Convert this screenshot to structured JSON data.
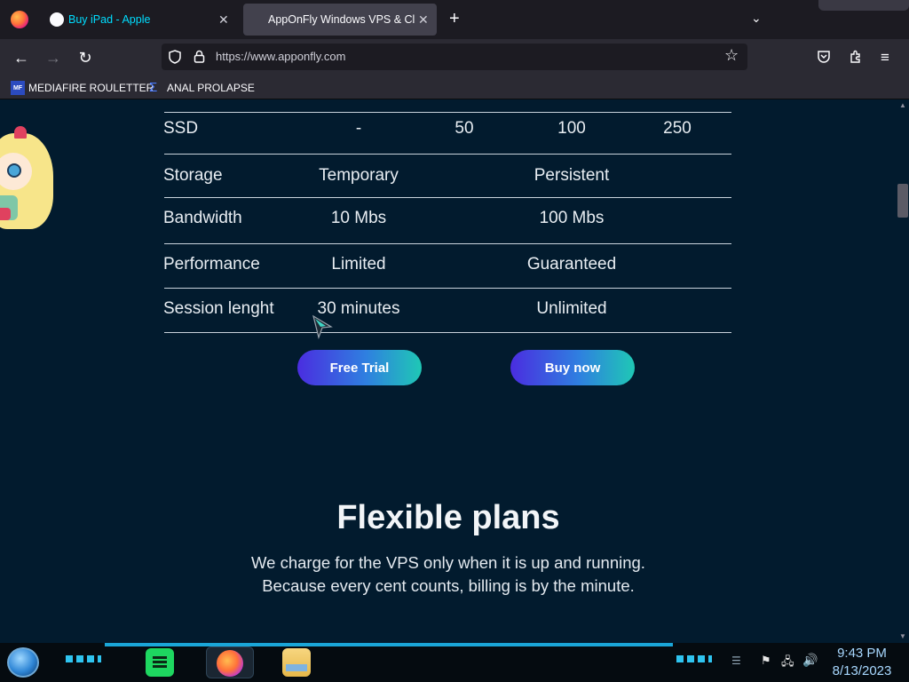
{
  "browser": {
    "tabs": [
      {
        "label": "Buy iPad - Apple",
        "active": false
      },
      {
        "label": "AppOnFly Windows VPS & Clo",
        "active": true
      }
    ],
    "url": "https://www.apponfly.com",
    "bookmarks": [
      {
        "label": "MEDIAFIRE ROULETTER",
        "icon_text": "MF"
      },
      {
        "label": "ANAL PROLAPSE"
      }
    ]
  },
  "comparison_table": {
    "rows": [
      {
        "label": "SSD",
        "values": [
          "-",
          "50",
          "100",
          "250"
        ]
      },
      {
        "label": "Storage",
        "values": [
          "Temporary",
          "Persistent"
        ]
      },
      {
        "label": "Bandwidth",
        "values": [
          "10 Mbs",
          "100 Mbs"
        ]
      },
      {
        "label": "Performance",
        "values": [
          "Limited",
          "Guaranteed"
        ]
      },
      {
        "label": "Session lenght",
        "values": [
          "30 minutes",
          "Unlimited"
        ]
      }
    ],
    "buttons": {
      "free_trial": "Free Trial",
      "buy_now": "Buy now"
    }
  },
  "plans_section": {
    "title": "Flexible plans",
    "line1": "We charge for the VPS only when it is up and running.",
    "line2": "Because every cent counts, billing is by the minute."
  },
  "taskbar": {
    "time": "9:43 PM",
    "date": "8/13/2023"
  },
  "colors": {
    "page_bg": "#021b2e",
    "button_gradient_start": "#4a2de0",
    "button_gradient_end": "#1fc8b5",
    "tab_accent": "#00ddff"
  }
}
